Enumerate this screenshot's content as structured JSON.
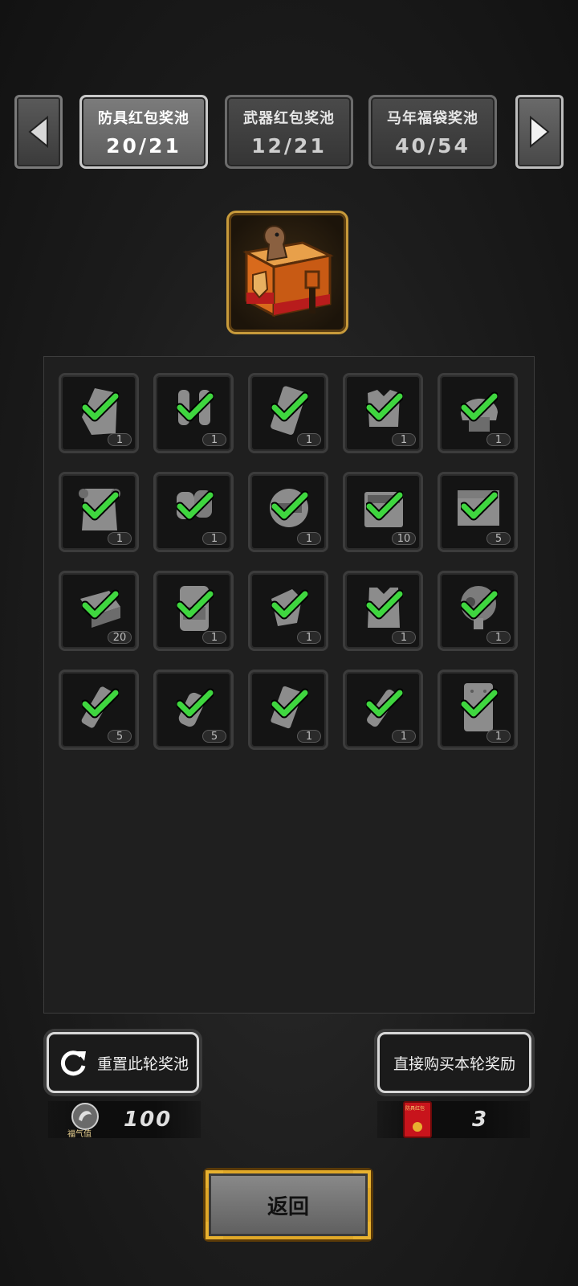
{
  "tabs": [
    {
      "name": "防具红包奖池",
      "count": "20/21",
      "active": true
    },
    {
      "name": "武器红包奖池",
      "count": "12/21",
      "active": false
    },
    {
      "name": "马年福袋奖池",
      "count": "40/54",
      "active": false
    }
  ],
  "items": [
    {
      "icon": "shield-icon",
      "qty": "1"
    },
    {
      "icon": "arm-guards-icon",
      "qty": "1"
    },
    {
      "icon": "armor-plate-icon",
      "qty": "1"
    },
    {
      "icon": "chest-armor-icon",
      "qty": "1"
    },
    {
      "icon": "tactical-helmet-icon",
      "qty": "1"
    },
    {
      "icon": "heavy-body-armor-icon",
      "qty": "1"
    },
    {
      "icon": "knee-pads-icon",
      "qty": "1"
    },
    {
      "icon": "visor-helmet-icon",
      "qty": "1"
    },
    {
      "icon": "repair-kit-icon",
      "qty": "10"
    },
    {
      "icon": "toolbox-icon",
      "qty": "5"
    },
    {
      "icon": "parts-box-icon",
      "qty": "20"
    },
    {
      "icon": "backpack-icon",
      "qty": "1"
    },
    {
      "icon": "gloves-icon",
      "qty": "1"
    },
    {
      "icon": "tactical-vest-icon",
      "qty": "1"
    },
    {
      "icon": "gas-mask-icon",
      "qty": "1"
    },
    {
      "icon": "smoke-grenade-icon",
      "qty": "5"
    },
    {
      "icon": "frag-grenade-icon",
      "qty": "5"
    },
    {
      "icon": "explosive-charge-icon",
      "qty": "1"
    },
    {
      "icon": "flashbang-icon",
      "qty": "1"
    },
    {
      "icon": "riot-shield-icon",
      "qty": "1"
    }
  ],
  "reset_label": "重置此轮奖池",
  "buy_label": "直接购买本轮奖励",
  "luck_icon_label": "福气值",
  "luck_value": "100",
  "ticket_icon_label": "防具红包",
  "ticket_value": "3",
  "back_label": "返回",
  "colors": {
    "check": "#3fd63f",
    "chest_frame": "#c79a3b",
    "back_border": "#e0a828"
  }
}
